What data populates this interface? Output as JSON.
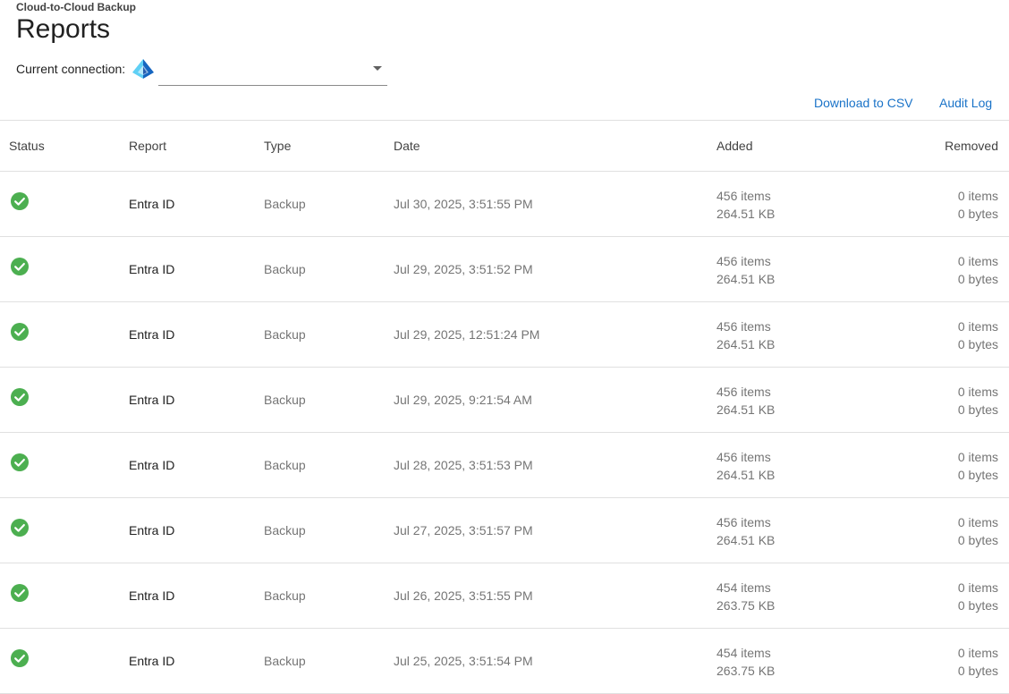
{
  "header": {
    "app_subtitle": "Cloud-to-Cloud Backup",
    "title": "Reports",
    "connection_label": "Current connection:",
    "connection_value": ""
  },
  "toolbar": {
    "download_csv": "Download to CSV",
    "audit_log": "Audit Log"
  },
  "table": {
    "columns": {
      "status": "Status",
      "report": "Report",
      "type": "Type",
      "date": "Date",
      "added": "Added",
      "removed": "Removed"
    },
    "rows": [
      {
        "status": "success",
        "report": "Entra ID",
        "type": "Backup",
        "date": "Jul 30, 2025, 3:51:55 PM",
        "added_items": "456 items",
        "added_size": "264.51 KB",
        "removed_items": "0 items",
        "removed_size": "0 bytes"
      },
      {
        "status": "success",
        "report": "Entra ID",
        "type": "Backup",
        "date": "Jul 29, 2025, 3:51:52 PM",
        "added_items": "456 items",
        "added_size": "264.51 KB",
        "removed_items": "0 items",
        "removed_size": "0 bytes"
      },
      {
        "status": "success",
        "report": "Entra ID",
        "type": "Backup",
        "date": "Jul 29, 2025, 12:51:24 PM",
        "added_items": "456 items",
        "added_size": "264.51 KB",
        "removed_items": "0 items",
        "removed_size": "0 bytes"
      },
      {
        "status": "success",
        "report": "Entra ID",
        "type": "Backup",
        "date": "Jul 29, 2025, 9:21:54 AM",
        "added_items": "456 items",
        "added_size": "264.51 KB",
        "removed_items": "0 items",
        "removed_size": "0 bytes"
      },
      {
        "status": "success",
        "report": "Entra ID",
        "type": "Backup",
        "date": "Jul 28, 2025, 3:51:53 PM",
        "added_items": "456 items",
        "added_size": "264.51 KB",
        "removed_items": "0 items",
        "removed_size": "0 bytes"
      },
      {
        "status": "success",
        "report": "Entra ID",
        "type": "Backup",
        "date": "Jul 27, 2025, 3:51:57 PM",
        "added_items": "456 items",
        "added_size": "264.51 KB",
        "removed_items": "0 items",
        "removed_size": "0 bytes"
      },
      {
        "status": "success",
        "report": "Entra ID",
        "type": "Backup",
        "date": "Jul 26, 2025, 3:51:55 PM",
        "added_items": "454 items",
        "added_size": "263.75 KB",
        "removed_items": "0 items",
        "removed_size": "0 bytes"
      },
      {
        "status": "success",
        "report": "Entra ID",
        "type": "Backup",
        "date": "Jul 25, 2025, 3:51:54 PM",
        "added_items": "454 items",
        "added_size": "263.75 KB",
        "removed_items": "0 items",
        "removed_size": "0 bytes"
      }
    ]
  },
  "icons": {
    "status_success": "check-circle-icon",
    "connection": "entra-id-icon"
  },
  "colors": {
    "success": "#4caf50",
    "link": "#1a73c8",
    "entra_light": "#5fd0f5",
    "entra_dark": "#1565c0"
  }
}
